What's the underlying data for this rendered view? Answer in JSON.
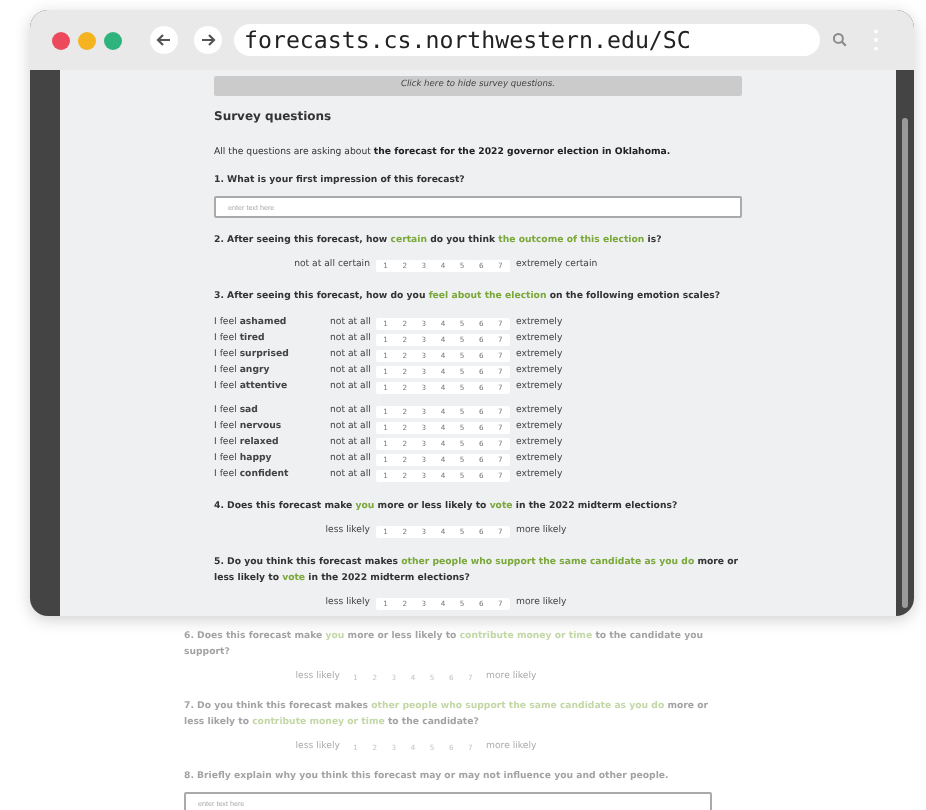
{
  "browser": {
    "url": "forecasts.cs.northwestern.edu/SC"
  },
  "toggle_bar": {
    "label": "Click here to hide survey questions."
  },
  "title": "Survey questions",
  "intro": "All the questions are asking about **the forecast for the 2022 governor election in Oklahoma.**",
  "questions": [
    {
      "kind": "text",
      "dimmed": false,
      "parts": [
        {
          "text": "1. What is your first impression of this forecast?",
          "accent": false
        }
      ],
      "placeholder": "enter text here"
    },
    {
      "kind": "scale",
      "dimmed": false,
      "parts": [
        {
          "text": "2. After seeing this forecast, how ",
          "accent": false
        },
        {
          "text": "certain",
          "accent": true
        },
        {
          "text": " do you think ",
          "accent": false
        },
        {
          "text": "the outcome of this election",
          "accent": true
        },
        {
          "text": " is?",
          "accent": false
        }
      ],
      "low": "not at all certain",
      "high": "extremely certain",
      "points": [
        "1",
        "2",
        "3",
        "4",
        "5",
        "6",
        "7"
      ]
    },
    {
      "kind": "grid",
      "dimmed": false,
      "parts": [
        {
          "text": "3. After seeing this forecast, how do you ",
          "accent": false
        },
        {
          "text": "feel about the election",
          "accent": true
        },
        {
          "text": " on the following emotion scales?",
          "accent": false
        }
      ],
      "groups": [
        [
          {
            "label": "I feel **ashamed**",
            "low": "not at all",
            "high": "extremely",
            "points": [
              "1",
              "2",
              "3",
              "4",
              "5",
              "6",
              "7"
            ]
          },
          {
            "label": "I feel **tired**",
            "low": "not at all",
            "high": "extremely",
            "points": [
              "1",
              "2",
              "3",
              "4",
              "5",
              "6",
              "7"
            ]
          },
          {
            "label": "I feel **surprised**",
            "low": "not at all",
            "high": "extremely",
            "points": [
              "1",
              "2",
              "3",
              "4",
              "5",
              "6",
              "7"
            ]
          },
          {
            "label": "I feel **angry**",
            "low": "not at all",
            "high": "extremely",
            "points": [
              "1",
              "2",
              "3",
              "4",
              "5",
              "6",
              "7"
            ]
          },
          {
            "label": "I feel **attentive**",
            "low": "not at all",
            "high": "extremely",
            "points": [
              "1",
              "2",
              "3",
              "4",
              "5",
              "6",
              "7"
            ]
          }
        ],
        [
          {
            "label": "I feel **sad**",
            "low": "not at all",
            "high": "extremely",
            "points": [
              "1",
              "2",
              "3",
              "4",
              "5",
              "6",
              "7"
            ]
          },
          {
            "label": "I feel **nervous**",
            "low": "not at all",
            "high": "extremely",
            "points": [
              "1",
              "2",
              "3",
              "4",
              "5",
              "6",
              "7"
            ]
          },
          {
            "label": "I feel **relaxed**",
            "low": "not at all",
            "high": "extremely",
            "points": [
              "1",
              "2",
              "3",
              "4",
              "5",
              "6",
              "7"
            ]
          },
          {
            "label": "I feel **happy**",
            "low": "not at all",
            "high": "extremely",
            "points": [
              "1",
              "2",
              "3",
              "4",
              "5",
              "6",
              "7"
            ]
          },
          {
            "label": "I feel **confident**",
            "low": "not at all",
            "high": "extremely",
            "points": [
              "1",
              "2",
              "3",
              "4",
              "5",
              "6",
              "7"
            ]
          }
        ]
      ]
    },
    {
      "kind": "scale",
      "dimmed": false,
      "parts": [
        {
          "text": "4. Does this forecast make ",
          "accent": false
        },
        {
          "text": "you",
          "accent": true
        },
        {
          "text": " more or less likely to ",
          "accent": false
        },
        {
          "text": "vote",
          "accent": true
        },
        {
          "text": " in the 2022 midterm elections?",
          "accent": false
        }
      ],
      "low": "less likely",
      "high": "more likely",
      "points": [
        "1",
        "2",
        "3",
        "4",
        "5",
        "6",
        "7"
      ]
    },
    {
      "kind": "scale",
      "dimmed": false,
      "parts": [
        {
          "text": "5. Do you think this forecast makes ",
          "accent": false
        },
        {
          "text": "other people who support the same candidate as you do",
          "accent": true
        },
        {
          "text": " more or less likely to ",
          "accent": false
        },
        {
          "text": "vote",
          "accent": true
        },
        {
          "text": " in the 2022 midterm elections?",
          "accent": false
        }
      ],
      "low": "less likely",
      "high": "more likely",
      "points": [
        "1",
        "2",
        "3",
        "4",
        "5",
        "6",
        "7"
      ]
    },
    {
      "kind": "scale",
      "dimmed": true,
      "parts": [
        {
          "text": "6. Does this forecast make ",
          "accent": false
        },
        {
          "text": "you",
          "accent": true
        },
        {
          "text": " more or less likely to ",
          "accent": false
        },
        {
          "text": "contribute money or time",
          "accent": true
        },
        {
          "text": " to the candidate you support?",
          "accent": false
        }
      ],
      "low": "less likely",
      "high": "more likely",
      "points": [
        "1",
        "2",
        "3",
        "4",
        "5",
        "6",
        "7"
      ]
    },
    {
      "kind": "scale",
      "dimmed": true,
      "parts": [
        {
          "text": "7. Do you think this forecast makes ",
          "accent": false
        },
        {
          "text": "other people who support the same candidate as you do",
          "accent": true
        },
        {
          "text": " more or less likely to ",
          "accent": false
        },
        {
          "text": "contribute money or time",
          "accent": true
        },
        {
          "text": " to the candidate?",
          "accent": false
        }
      ],
      "low": "less likely",
      "high": "more likely",
      "points": [
        "1",
        "2",
        "3",
        "4",
        "5",
        "6",
        "7"
      ]
    },
    {
      "kind": "text",
      "dimmed": true,
      "parts": [
        {
          "text": "8. Briefly explain why you think this forecast may or may not influence you and other people.",
          "accent": false
        }
      ],
      "placeholder": "enter text here"
    }
  ]
}
